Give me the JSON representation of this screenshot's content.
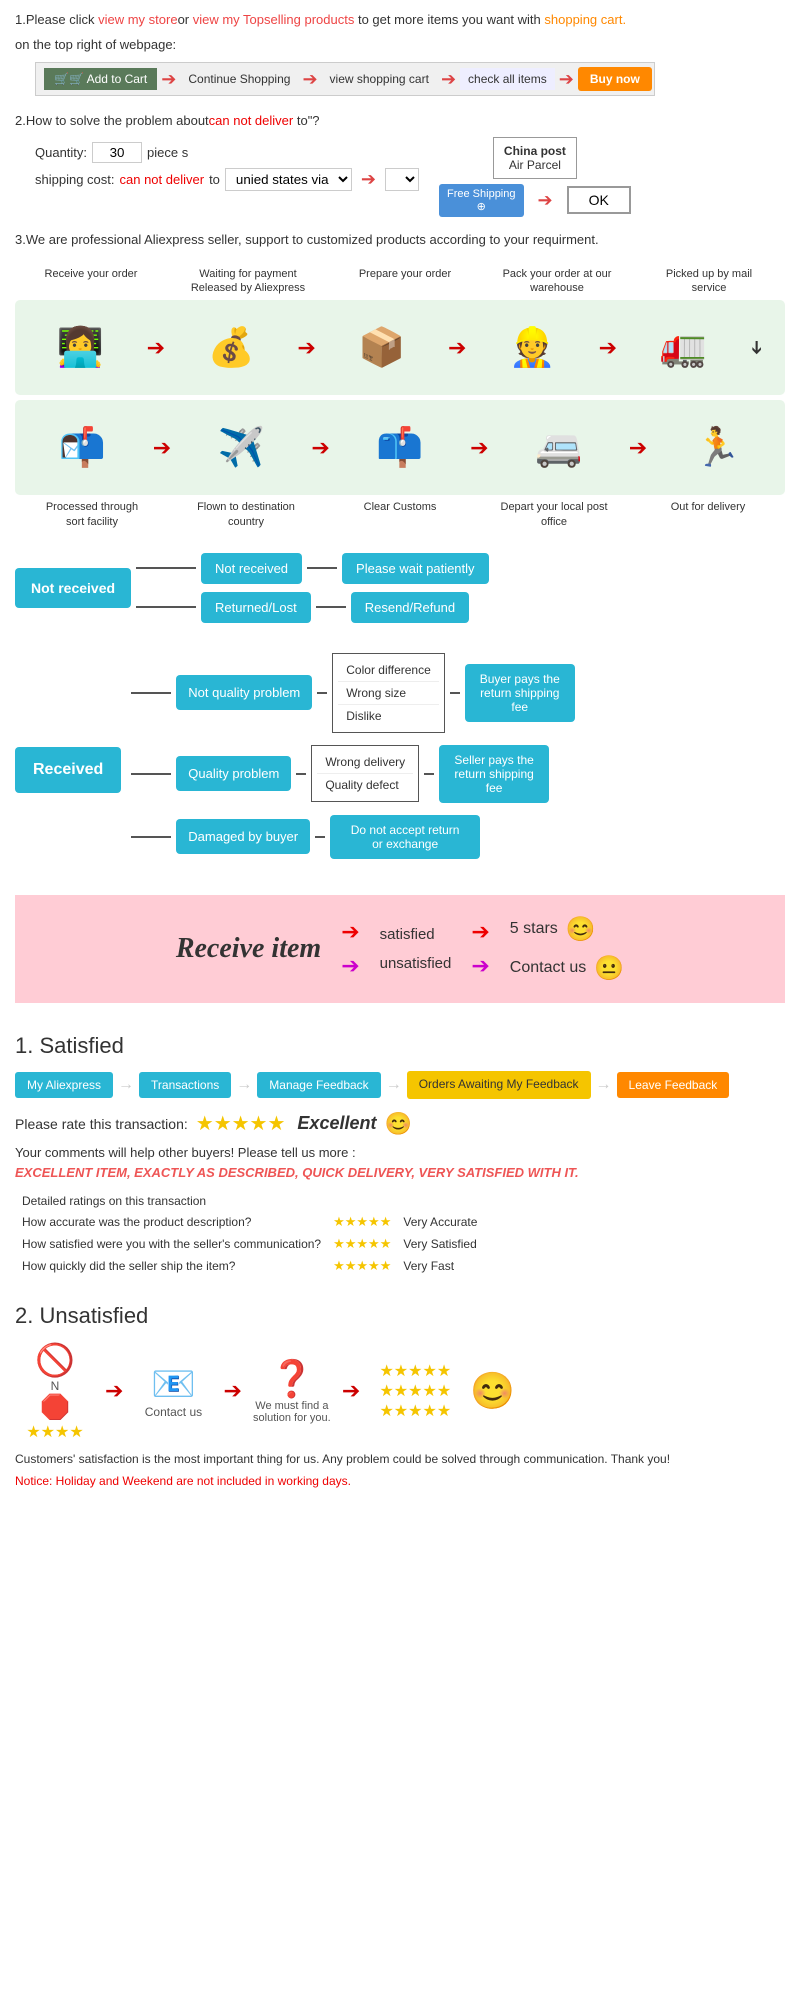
{
  "section1": {
    "text1": "1.Please click ",
    "link1": "view my store",
    "text2": "or ",
    "link2": "view my Topselling products",
    "text3": " to get more items you want with ",
    "link3": "shopping cart.",
    "text4": "on the top right of webpage:",
    "steps": [
      {
        "label": "🛒 Add to Cart",
        "type": "cart"
      },
      {
        "label": "Continue Shopping",
        "type": "normal"
      },
      {
        "label": "view shopping cart",
        "type": "normal"
      },
      {
        "label": "check all items",
        "type": "normal"
      },
      {
        "label": "Buy now",
        "type": "buynow"
      }
    ]
  },
  "section2": {
    "title": "2.How to solve the problem about",
    "red_text": "can not deliver",
    "title2": " to\"?",
    "qty_label": "Quantity:",
    "qty_value": "30",
    "qty_unit": "piece s",
    "shipping_label": "shipping cost:",
    "shipping_red": "can not deliver",
    "shipping_to": " to ",
    "shipping_via": "unied states via",
    "china_post_title": "China post",
    "china_post_sub": "Air Parcel",
    "free_shipping": "Free Shipping",
    "ok_btn": "OK"
  },
  "section3": {
    "text": "3.We are professional Aliexpress seller, support to customized products according to your requirment."
  },
  "process": {
    "top_labels": [
      "Receive your order",
      "Waiting for payment Released by Aliexpress",
      "Prepare your order",
      "Pack your order at our warehouse",
      "Picked up by mail service"
    ],
    "top_icons": [
      "👩‍💻",
      "💰",
      "📦",
      "👷",
      "🚛"
    ],
    "bottom_icons": [
      "🏃",
      "🚐",
      "📫",
      "✈️",
      "📬"
    ],
    "bottom_labels": [
      "Out for delivery",
      "Depart your local post office",
      "Clear Customs",
      "Flown to destination country",
      "Processed through sort facility"
    ]
  },
  "not_received": {
    "main": "Not received",
    "branch1": "Not received",
    "branch1_result": "Please wait patiently",
    "branch2": "Returned/Lost",
    "branch2_result": "Resend/Refund"
  },
  "received": {
    "main": "Received",
    "branch1_title": "Not quality problem",
    "branch1_items": [
      "Color difference",
      "Wrong size",
      "Dislike"
    ],
    "branch1_result": "Buyer pays the return shipping fee",
    "branch2_title": "Quality problem",
    "branch2_items": [
      "Wrong delivery",
      "Quality defect"
    ],
    "branch2_result": "Seller pays the return shipping fee",
    "branch3_title": "Damaged by buyer",
    "branch3_result": "Do not accept return or exchange"
  },
  "pink_section": {
    "title": "Receive item",
    "satisfied": "satisfied",
    "unsatisfied": "unsatisfied",
    "result1": "5 stars",
    "result2": "Contact us",
    "emoji1": "😊",
    "emoji2": "😐"
  },
  "satisfied": {
    "title": "1. Satisfied",
    "steps": [
      "My Aliexpress",
      "Transactions",
      "Manage Feedback",
      "Orders Awaiting My Feedback",
      "Leave Feedback"
    ],
    "rate_label": "Please rate this transaction:",
    "stars": "★★★★★",
    "excellent": "Excellent",
    "emoji": "😊",
    "comments": "Your comments will help other buyers! Please tell us more :",
    "comment_text": "EXCELLENT ITEM, EXACTLY AS DESCRIBED, QUICK DELIVERY, VERY SATISFIED WITH IT.",
    "ratings_title": "Detailed ratings on this transaction",
    "ratings": [
      {
        "label": "How accurate was the product description?",
        "stars": "★★★★★",
        "value": "Very Accurate"
      },
      {
        "label": "How satisfied were you with the seller's communication?",
        "stars": "★★★★★",
        "value": "Very Satisfied"
      },
      {
        "label": "How quickly did the seller ship the item?",
        "stars": "★★★★★",
        "value": "Very Fast"
      }
    ]
  },
  "unsatisfied": {
    "title": "2. Unsatisfied",
    "steps_label": "Contact us",
    "find_solution": "We must find a solution for you.",
    "icons": [
      "🚫⭐",
      "📧",
      "❓",
      "⭐⭐⭐⭐⭐"
    ],
    "notice": "Customers' satisfaction is the most important thing for us. Any problem could be solved through communication. Thank you!",
    "notice_holiday": "Notice: Holiday and Weekend are not included in working days."
  }
}
